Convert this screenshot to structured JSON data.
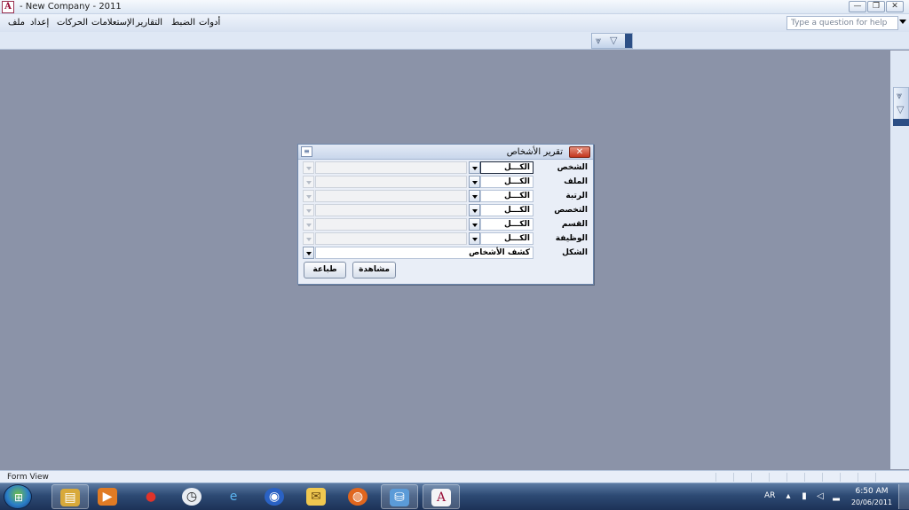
{
  "window": {
    "title": "- New Company - 2011",
    "app_icon": "access-icon",
    "minimize_label": "—",
    "restore_label": "❐",
    "close_label": "✕"
  },
  "menu": {
    "items": [
      "ملف",
      "إعداد",
      "الحركات",
      "الإستعلامات",
      "التقارير",
      "الضبط",
      "أدوات"
    ]
  },
  "help": {
    "placeholder": "Type a question for help"
  },
  "dialog": {
    "title": "تقرير الأشخاص",
    "close_label": "✕",
    "fields": [
      {
        "label": "الشخص",
        "value": "الكـــل"
      },
      {
        "label": "الملف",
        "value": "الكـــل"
      },
      {
        "label": "الرتبة",
        "value": "الكـــل"
      },
      {
        "label": "التخصص",
        "value": "الكـــل"
      },
      {
        "label": "القسم",
        "value": "الكـــل"
      },
      {
        "label": "الوظيفة",
        "value": "الكـــل"
      }
    ],
    "shape": {
      "label": "الشكل",
      "value": "كشف الأشخاص"
    },
    "buttons": {
      "view": "مشاهدة",
      "print": "طباعة"
    }
  },
  "status": {
    "text": "Form View"
  },
  "taskbar": {
    "apps": [
      "explorer-icon",
      "media-player-icon",
      "pin-icon",
      "clock-icon",
      "internet-explorer-icon",
      "messenger-icon",
      "mail-icon",
      "firefox-icon",
      "network-icon",
      "access-icon"
    ],
    "language": "AR",
    "time": "6:50 AM",
    "date": "20/06/2011"
  },
  "colors": {
    "workspace": "#8b93a8",
    "taskbar": "#1d3257",
    "dialog_close": "#c2361e"
  }
}
